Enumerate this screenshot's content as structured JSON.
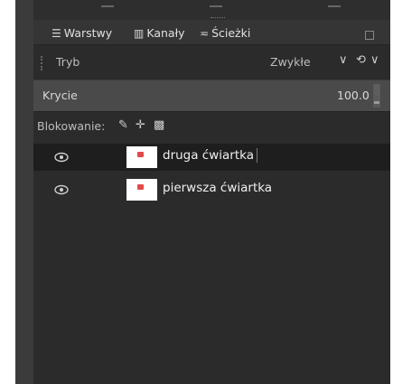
{
  "tabs": [
    {
      "label": "Warstwy",
      "icon": "layers-icon"
    },
    {
      "label": "Kanały",
      "icon": "channels-icon"
    },
    {
      "label": "Ścieżki",
      "icon": "paths-icon"
    }
  ],
  "mode": {
    "label": "Tryb",
    "value": "Zwykłe"
  },
  "opacity": {
    "label": "Krycie",
    "value": "100.0"
  },
  "lock": {
    "label": "Blokowanie:"
  },
  "layers": [
    {
      "name": "druga ćwiartka",
      "selected": true,
      "visible": true
    },
    {
      "name": "pierwsza ćwiartka",
      "selected": false,
      "visible": true
    }
  ],
  "colors": {
    "panel_bg": "#2b2b2b",
    "selected_row": "#1e1e1e",
    "thumb_mark": "#e04a4a"
  }
}
